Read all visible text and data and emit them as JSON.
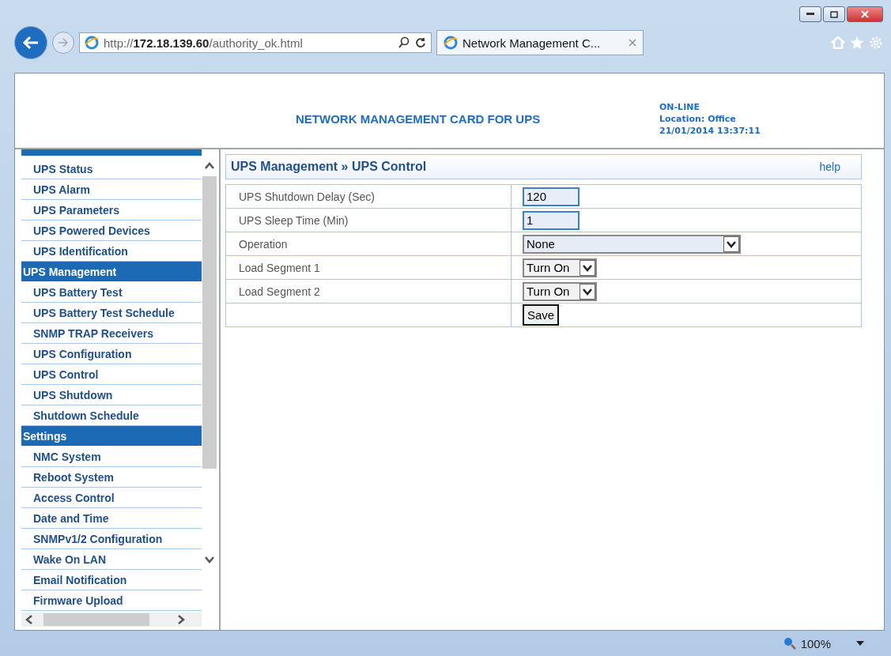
{
  "browser": {
    "address": "http://**172.18.139.60**/authority_ok.html",
    "tab_title": "Network Management C...",
    "zoom": "100%"
  },
  "header": {
    "title": "NETWORK MANAGEMENT CARD FOR UPS",
    "status": "ON-LINE",
    "location": "Location: Office",
    "datetime": "21/01/2014 13:37:11"
  },
  "sidebar": {
    "items": [
      {
        "kind": "clipped"
      },
      {
        "kind": "item",
        "label": "UPS Status"
      },
      {
        "kind": "item",
        "label": "UPS Alarm"
      },
      {
        "kind": "item",
        "label": "UPS Parameters"
      },
      {
        "kind": "item",
        "label": "UPS Powered Devices"
      },
      {
        "kind": "item",
        "label": "UPS Identification"
      },
      {
        "kind": "header",
        "label": "UPS Management"
      },
      {
        "kind": "item",
        "label": "UPS Battery Test"
      },
      {
        "kind": "item",
        "label": "UPS Battery Test Schedule"
      },
      {
        "kind": "item",
        "label": "SNMP TRAP Receivers"
      },
      {
        "kind": "item",
        "label": "UPS Configuration"
      },
      {
        "kind": "item",
        "label": "UPS Control"
      },
      {
        "kind": "item",
        "label": "UPS Shutdown"
      },
      {
        "kind": "item",
        "label": "Shutdown Schedule"
      },
      {
        "kind": "header",
        "label": "Settings"
      },
      {
        "kind": "item",
        "label": "NMC System"
      },
      {
        "kind": "item",
        "label": "Reboot System"
      },
      {
        "kind": "item",
        "label": "Access Control"
      },
      {
        "kind": "item",
        "label": "Date and Time"
      },
      {
        "kind": "item",
        "label": "SNMPv1/2 Configuration"
      },
      {
        "kind": "item",
        "label": "Wake On LAN"
      },
      {
        "kind": "item",
        "label": "Email Notification"
      },
      {
        "kind": "item",
        "label": "Firmware Upload"
      }
    ]
  },
  "panel": {
    "title": "UPS Management » UPS Control",
    "help": "help",
    "rows": [
      {
        "kind": "input",
        "label": "UPS Shutdown Delay (Sec)",
        "value": "120"
      },
      {
        "kind": "input",
        "label": "UPS Sleep Time (Min)",
        "value": "1"
      },
      {
        "kind": "wide_select",
        "label": "Operation",
        "value": "None"
      },
      {
        "kind": "select",
        "label": "Load Segment 1",
        "value": "Turn On"
      },
      {
        "kind": "select",
        "label": "Load Segment 2",
        "value": "Turn On"
      },
      {
        "kind": "button",
        "value": "Save"
      }
    ]
  }
}
